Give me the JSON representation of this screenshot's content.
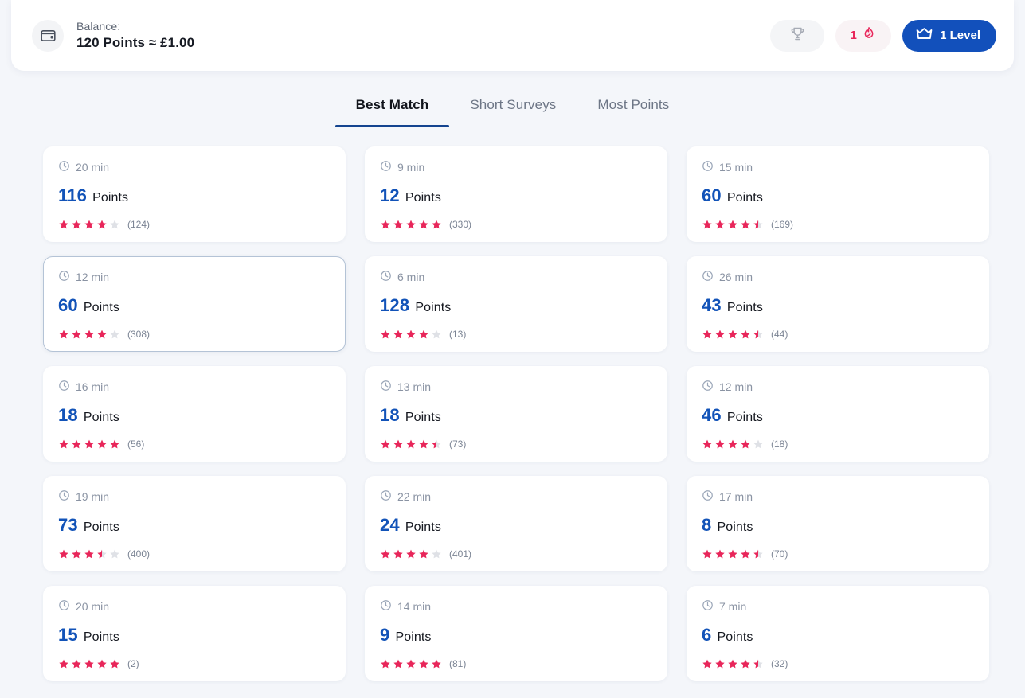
{
  "header": {
    "wallet_icon": "wallet-icon",
    "balance_label": "Balance:",
    "balance_value": "120 Points ≈ £1.00",
    "trophy_icon": "trophy-icon",
    "streak_count": "1",
    "streak_icon": "flame-icon",
    "level_icon": "crown-icon",
    "level_label": "1 Level",
    "accent_blue": "#1250bb",
    "accent_pink": "#e8265a"
  },
  "tabs": [
    {
      "label": "Best Match",
      "active": true
    },
    {
      "label": "Short Surveys",
      "active": false
    },
    {
      "label": "Most Points",
      "active": false
    }
  ],
  "surveys": [
    {
      "duration": "20 min",
      "points": "116",
      "points_word": "Points",
      "rating": 4,
      "rating_count": "(124)",
      "selected": false
    },
    {
      "duration": "9 min",
      "points": "12",
      "points_word": "Points",
      "rating": 5,
      "rating_count": "(330)",
      "selected": false
    },
    {
      "duration": "15 min",
      "points": "60",
      "points_word": "Points",
      "rating": 4.5,
      "rating_count": "(169)",
      "selected": false
    },
    {
      "duration": "12 min",
      "points": "60",
      "points_word": "Points",
      "rating": 4,
      "rating_count": "(308)",
      "selected": true
    },
    {
      "duration": "6 min",
      "points": "128",
      "points_word": "Points",
      "rating": 4,
      "rating_count": "(13)",
      "selected": false
    },
    {
      "duration": "26 min",
      "points": "43",
      "points_word": "Points",
      "rating": 4.5,
      "rating_count": "(44)",
      "selected": false
    },
    {
      "duration": "16 min",
      "points": "18",
      "points_word": "Points",
      "rating": 5,
      "rating_count": "(56)",
      "selected": false
    },
    {
      "duration": "13 min",
      "points": "18",
      "points_word": "Points",
      "rating": 4.5,
      "rating_count": "(73)",
      "selected": false
    },
    {
      "duration": "12 min",
      "points": "46",
      "points_word": "Points",
      "rating": 4,
      "rating_count": "(18)",
      "selected": false
    },
    {
      "duration": "19 min",
      "points": "73",
      "points_word": "Points",
      "rating": 3.5,
      "rating_count": "(400)",
      "selected": false
    },
    {
      "duration": "22 min",
      "points": "24",
      "points_word": "Points",
      "rating": 4,
      "rating_count": "(401)",
      "selected": false
    },
    {
      "duration": "17 min",
      "points": "8",
      "points_word": "Points",
      "rating": 4.5,
      "rating_count": "(70)",
      "selected": false
    },
    {
      "duration": "20 min",
      "points": "15",
      "points_word": "Points",
      "rating": 5,
      "rating_count": "(2)",
      "selected": false
    },
    {
      "duration": "14 min",
      "points": "9",
      "points_word": "Points",
      "rating": 5,
      "rating_count": "(81)",
      "selected": false
    },
    {
      "duration": "7 min",
      "points": "6",
      "points_word": "Points",
      "rating": 4.5,
      "rating_count": "(32)",
      "selected": false
    }
  ]
}
